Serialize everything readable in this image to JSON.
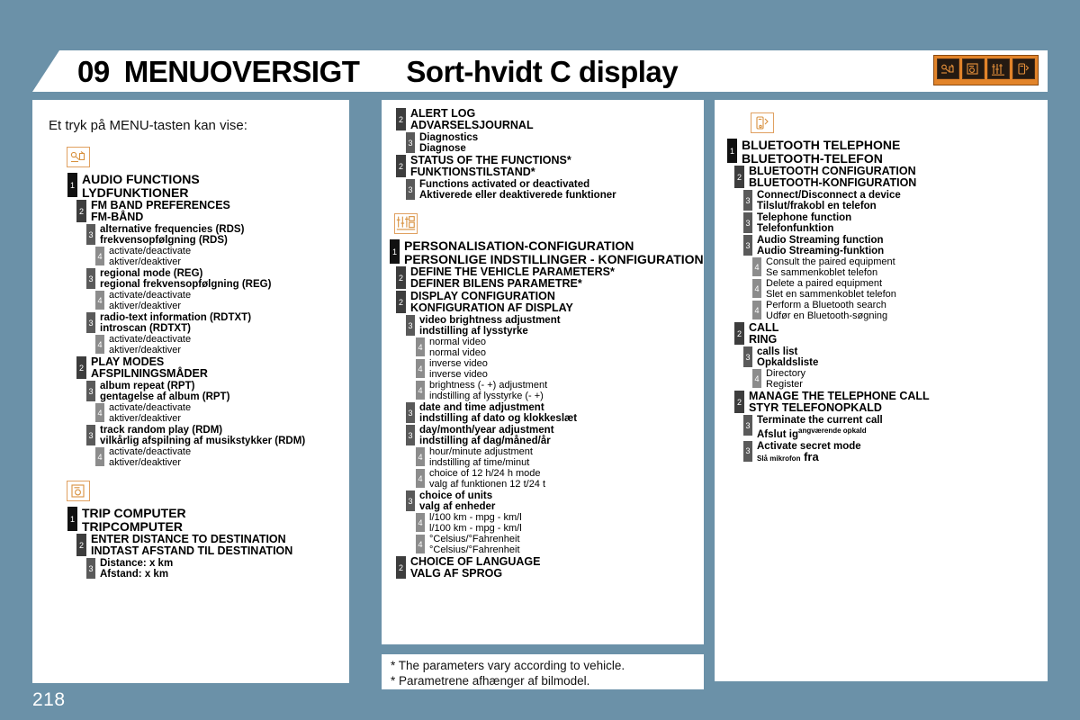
{
  "header": {
    "chapter_number": "09",
    "chapter_title": "MENUOVERSIGT",
    "chapter_subtitle": "Sort-hvidt C display",
    "badge_icons": [
      "audio-functions-icon",
      "trip-computer-icon",
      "personalisation-icon",
      "bluetooth-phone-icon"
    ]
  },
  "page_number": "218",
  "left_column": {
    "intro": "Et tryk på MENU-tasten kan vise:",
    "sections": [
      {
        "icon": "audio-functions-icon",
        "rows": [
          {
            "level": 1,
            "en": "AUDIO FUNCTIONS",
            "da": "LYDFUNKTIONER"
          },
          {
            "level": 2,
            "en": "FM BAND PREFERENCES",
            "da": "FM-BÅND"
          },
          {
            "level": 3,
            "en": "alternative frequencies (RDS)",
            "da": "frekvensopfølgning (RDS)"
          },
          {
            "level": 4,
            "en": "activate/deactivate",
            "da": "aktiver/deaktiver"
          },
          {
            "level": 3,
            "en": "regional mode (REG)",
            "da": "regional frekvensopfølgning (REG)"
          },
          {
            "level": 4,
            "en": "activate/deactivate",
            "da": "aktiver/deaktiver"
          },
          {
            "level": 3,
            "en": "radio-text information (RDTXT)",
            "da": "introscan (RDTXT)"
          },
          {
            "level": 4,
            "en": "activate/deactivate",
            "da": "aktiver/deaktiver"
          },
          {
            "level": 2,
            "en": "PLAY MODES",
            "da": "AFSPILNINGSMÅDER"
          },
          {
            "level": 3,
            "en": "album repeat (RPT)",
            "da": "gentagelse af album (RPT)"
          },
          {
            "level": 4,
            "en": "activate/deactivate",
            "da": "aktiver/deaktiver"
          },
          {
            "level": 3,
            "en": "track random play (RDM)",
            "da": "vilkårlig afspilning af musikstykker (RDM)"
          },
          {
            "level": 4,
            "en": "activate/deactivate",
            "da": "aktiver/deaktiver"
          }
        ]
      },
      {
        "icon": "trip-computer-icon",
        "rows": [
          {
            "level": 1,
            "en": "TRIP COMPUTER",
            "da": "TRIPCOMPUTER"
          },
          {
            "level": 2,
            "en": "ENTER DISTANCE TO DESTINATION",
            "da": "INDTAST AFSTAND TIL DESTINATION"
          },
          {
            "level": 3,
            "en": "Distance: x km",
            "da": "Afstand: x km"
          }
        ]
      }
    ]
  },
  "middle_column": {
    "sections": [
      {
        "icon": null,
        "rows": [
          {
            "level": 2,
            "en": "ALERT LOG",
            "da": "ADVARSELSJOURNAL"
          },
          {
            "level": 3,
            "en": "Diagnostics",
            "da": "Diagnose"
          },
          {
            "level": 2,
            "en": "STATUS OF THE FUNCTIONS*",
            "da": "FUNKTIONSTILSTAND*"
          },
          {
            "level": 3,
            "en": "Functions activated or deactivated",
            "da": "Aktiverede eller deaktiverede funktioner"
          }
        ]
      },
      {
        "icon": "personalisation-icon",
        "rows": [
          {
            "level": 1,
            "en": "PERSONALISATION-CONFIGURATION",
            "da": "PERSONLIGE INDSTILLINGER - KONFIGURATION"
          },
          {
            "level": 2,
            "en": "DEFINE THE VEHICLE PARAMETERS*",
            "da": "DEFINER BILENS PARAMETRE*"
          },
          {
            "level": 2,
            "en": "DISPLAY CONFIGURATION",
            "da": "KONFIGURATION AF DISPLAY"
          },
          {
            "level": 3,
            "en": "video brightness adjustment",
            "da": "indstilling af lysstyrke"
          },
          {
            "level": 4,
            "en": "normal video",
            "da": "normal video"
          },
          {
            "level": 4,
            "en": "inverse video",
            "da": "inverse video"
          },
          {
            "level": 4,
            "en": "brightness (- +) adjustment",
            "da": "indstilling af lysstyrke (- +)"
          },
          {
            "level": 3,
            "en": "date and time adjustment",
            "da": "indstilling af dato og klokkeslæt"
          },
          {
            "level": 3,
            "en": "day/month/year adjustment",
            "da": "indstilling af dag/måned/år"
          },
          {
            "level": 4,
            "en": "hour/minute adjustment",
            "da": "indstilling af time/minut"
          },
          {
            "level": 4,
            "en": "choice of 12 h/24 h mode",
            "da": "valg af funktionen 12 t/24 t"
          },
          {
            "level": 3,
            "en": "choice of units",
            "da": "valg af enheder"
          },
          {
            "level": 4,
            "en": "l/100 km - mpg - km/l",
            "da": "l/100 km - mpg - km/l"
          },
          {
            "level": 4,
            "en": "°Celsius/°Fahrenheit",
            "da": "°Celsius/°Fahrenheit"
          },
          {
            "level": 2,
            "en": "CHOICE OF LANGUAGE",
            "da": "VALG AF SPROG"
          }
        ]
      }
    ],
    "footnote": {
      "line_en": "* The parameters vary according to vehicle.",
      "line_da": "* Parametrene afhænger af bilmodel."
    }
  },
  "right_column": {
    "sections": [
      {
        "icon": "bluetooth-phone-icon",
        "rows": [
          {
            "level": 1,
            "en": "BLUETOOTH TELEPHONE",
            "da": "BLUETOOTH-TELEFON"
          },
          {
            "level": 2,
            "en": "BLUETOOTH CONFIGURATION",
            "da": "BLUETOOTH-KONFIGURATION"
          },
          {
            "level": 3,
            "en": "Connect/Disconnect a device",
            "da": "Tilslut/frakobl en telefon"
          },
          {
            "level": 3,
            "en": "Telephone function",
            "da": "Telefonfunktion"
          },
          {
            "level": 3,
            "en": "Audio Streaming function",
            "da": "Audio Streaming-funktion"
          },
          {
            "level": 4,
            "en": "Consult the paired equipment",
            "da": "Se sammenkoblet telefon"
          },
          {
            "level": 4,
            "en": "Delete a paired equipment",
            "da": "Slet en sammenkoblet telefon"
          },
          {
            "level": 4,
            "en": "Perform a Bluetooth search",
            "da": "Udfør en Bluetooth-søgning"
          },
          {
            "level": 2,
            "en": "CALL",
            "da": "RING"
          },
          {
            "level": 3,
            "en": "calls list",
            "da": "Opkaldsliste"
          },
          {
            "level": 4,
            "en": "Directory",
            "da": "Register"
          },
          {
            "level": 2,
            "en": "MANAGE THE TELEPHONE CALL",
            "da": "STYR TELEFONOPKALD"
          },
          {
            "level": 3,
            "en": "Terminate the current call",
            "da": "Afslut ig",
            "da_sup": "angværende opkald"
          },
          {
            "level": 3,
            "en": "Activate secret mode",
            "da_pre": "Slå mikrofon",
            "da_post": "fra"
          }
        ]
      }
    ]
  }
}
